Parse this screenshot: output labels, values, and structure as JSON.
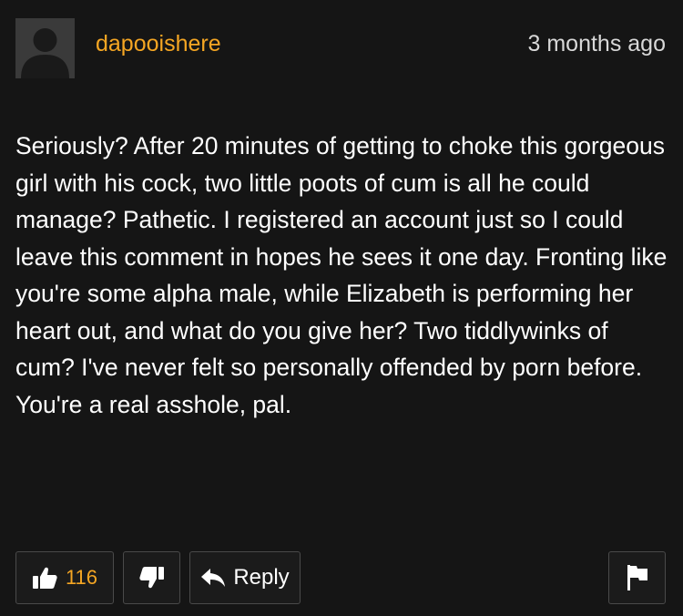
{
  "comment": {
    "username": "dapooishere",
    "timestamp": "3 months ago",
    "body": "Seriously? After 20 minutes of getting to choke this gorgeous girl with his cock, two little poots of cum is all he could manage? Pathetic. I registered an account just so I could leave this comment in hopes he sees it one day. Fronting like you're some alpha male, while Elizabeth is performing her heart out, and what do you give her? Two tiddlywinks of cum? I've never felt so personally offended by porn before. You're a real asshole, pal."
  },
  "actions": {
    "like_count": "116",
    "reply_label": "Reply"
  },
  "icons": {
    "avatar": "default-user-silhouette",
    "like": "thumbs-up-icon",
    "dislike": "thumbs-down-icon",
    "reply": "reply-arrow-icon",
    "flag": "flag-icon"
  },
  "colors": {
    "background": "#151515",
    "username": "#f5a623",
    "like_count": "#f5a623",
    "text": "#ffffff",
    "timestamp": "#d8d8d8",
    "button_border": "#4a4a4a"
  }
}
